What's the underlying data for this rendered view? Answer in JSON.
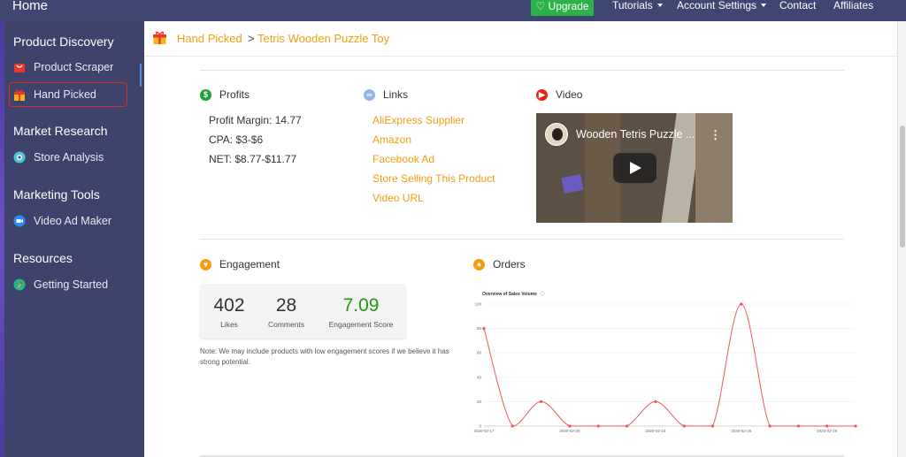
{
  "topbar": {
    "brand": "Home",
    "upgrade_label": "♡ Upgrade",
    "nav": [
      "Tutorials",
      "Account Settings",
      "Contact",
      "Affiliates"
    ]
  },
  "sidebar": {
    "sections": [
      {
        "title": "Product Discovery",
        "items": [
          {
            "label": "Product Scraper",
            "icon": "shopping-bag-icon"
          },
          {
            "label": "Hand Picked",
            "icon": "gift-icon",
            "active": true
          }
        ]
      },
      {
        "title": "Market Research",
        "items": [
          {
            "label": "Store Analysis",
            "icon": "eye-icon"
          }
        ]
      },
      {
        "title": "Marketing Tools",
        "items": [
          {
            "label": "Video Ad Maker",
            "icon": "video-camera-icon"
          }
        ]
      },
      {
        "title": "Resources",
        "items": [
          {
            "label": "Getting Started",
            "icon": "rocket-icon"
          }
        ]
      }
    ]
  },
  "breadcrumb": {
    "parent": "Hand Picked",
    "separator": ">",
    "current": "Tetris Wooden Puzzle Toy"
  },
  "profits": {
    "title": "Profits",
    "lines": [
      "Profit Margin: 14.77",
      "CPA: $3-$6",
      "NET: $8.77-$11.77"
    ]
  },
  "links": {
    "title": "Links",
    "items": [
      "AliExpress Supplier",
      "Amazon",
      "Facebook Ad",
      "Store Selling This Product",
      "Video URL"
    ]
  },
  "video": {
    "title": "Video",
    "thumbnail_title": "Wooden Tetris Puzzle ..."
  },
  "engagement": {
    "title": "Engagement",
    "likes": "402",
    "likes_label": "Likes",
    "comments": "28",
    "comments_label": "Comments",
    "score": "7.09",
    "score_label": "Engagement Score",
    "note": "Note: We may include products with low engagement scores if we believe it has strong potential."
  },
  "orders": {
    "title": "Orders"
  },
  "colors": {
    "accent": "#f39c12",
    "sidebar_bg": "#3d436b",
    "topbar_bg": "#3f4672",
    "upgrade_green": "#2db24a",
    "score_green": "#23960d",
    "chart_line": "#f2545b"
  },
  "chart_data": {
    "type": "line",
    "title": "Overview of Sales Volume",
    "ylim": [
      0,
      100
    ],
    "yticks": [
      0,
      20,
      40,
      60,
      80,
      100
    ],
    "xtick_labels": [
      "2020-02-17",
      "2020-02-20",
      "2020-02-23",
      "2020-02-26",
      "2020-02-29"
    ],
    "x": [
      "2020-02-17",
      "2020-02-18",
      "2020-02-19",
      "2020-02-20",
      "2020-02-21",
      "2020-02-22",
      "2020-02-23",
      "2020-02-24",
      "2020-02-25",
      "2020-02-26",
      "2020-02-27",
      "2020-02-28",
      "2020-02-29",
      "2020-03-01"
    ],
    "values": [
      80,
      0,
      20,
      0,
      0,
      0,
      20,
      0,
      0,
      100,
      0,
      0,
      0,
      0
    ]
  }
}
